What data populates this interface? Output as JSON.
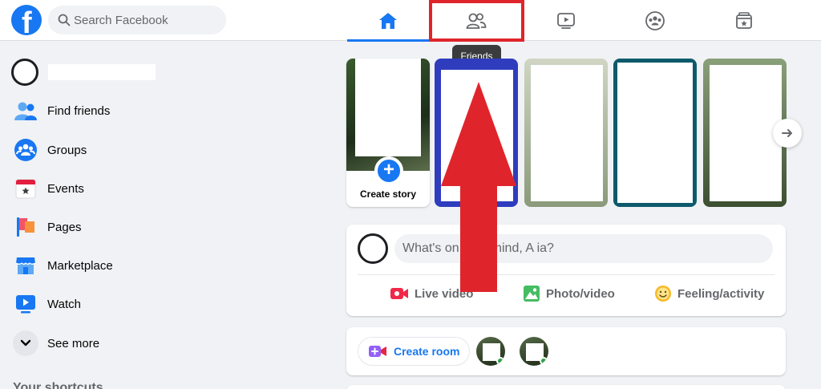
{
  "search": {
    "placeholder": "Search Facebook"
  },
  "nav": {
    "tabs": [
      {
        "name": "home",
        "icon": "home-icon",
        "active": true
      },
      {
        "name": "friends",
        "icon": "friends-icon",
        "active": false
      },
      {
        "name": "watch",
        "icon": "watch-icon",
        "active": false
      },
      {
        "name": "groups",
        "icon": "groups-icon",
        "active": false
      },
      {
        "name": "gaming",
        "icon": "gaming-icon",
        "active": false
      }
    ],
    "tooltip": "Friends"
  },
  "sidebar": {
    "items": [
      {
        "label": "Find friends",
        "icon": "friends-icon"
      },
      {
        "label": "Groups",
        "icon": "groups-icon"
      },
      {
        "label": "Events",
        "icon": "calendar-icon"
      },
      {
        "label": "Pages",
        "icon": "flag-icon"
      },
      {
        "label": "Marketplace",
        "icon": "shop-icon"
      },
      {
        "label": "Watch",
        "icon": "video-icon"
      },
      {
        "label": "See more",
        "icon": "chevron-down-icon"
      }
    ],
    "shortcuts_heading": "Your shortcuts"
  },
  "stories": {
    "create_label": "Create story"
  },
  "composer": {
    "placeholder": "What's on your mind, A    ia?",
    "actions": [
      {
        "label": "Live video",
        "icon": "live-video-icon"
      },
      {
        "label": "Photo/video",
        "icon": "photo-icon"
      },
      {
        "label": "Feeling/activity",
        "icon": "smiley-icon"
      }
    ]
  },
  "rooms": {
    "create_label": "Create room"
  },
  "colors": {
    "brand": "#1877f2",
    "annotation": "#e0242b"
  }
}
